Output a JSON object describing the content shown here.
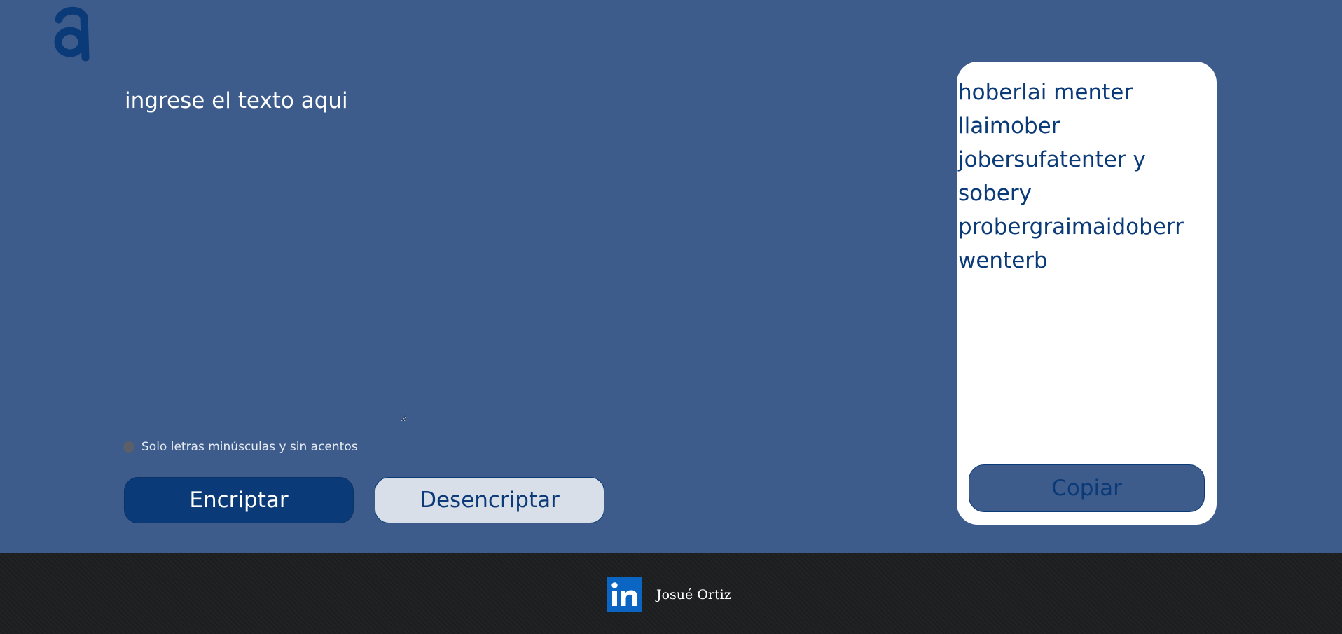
{
  "brand": {
    "logo_icon": "alura-a-logo-icon",
    "logo_color": "#0b3a78"
  },
  "input": {
    "placeholder": "ingrese el texto aqui",
    "value": ""
  },
  "hint": {
    "icon": "info-icon",
    "text": "Solo letras minúsculas y sin acentos"
  },
  "actions": {
    "encrypt_label": "Encriptar",
    "decrypt_label": "Desencriptar"
  },
  "output": {
    "text": "hoberlai menter llaimober jobersufatenter y sobery probergraimaidoberr wenterb",
    "copy_label": "Copiar"
  },
  "footer": {
    "social_icon": "linkedin-icon",
    "author": "Josué Ortiz"
  },
  "colors": {
    "background": "#3d5c8b",
    "primary": "#0b3a78",
    "secondary": "#d9dfe8",
    "card": "#ffffff",
    "footer": "#1c1e20",
    "linkedin": "#0a66c2"
  }
}
